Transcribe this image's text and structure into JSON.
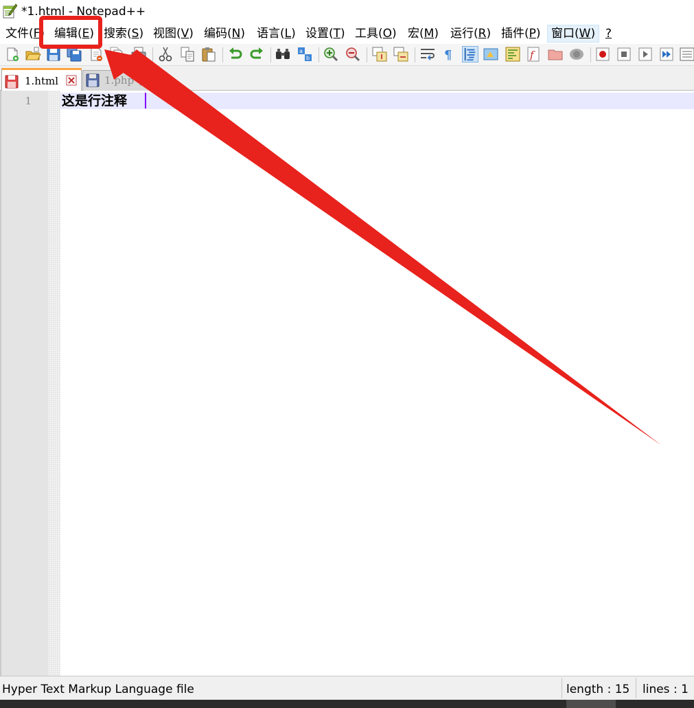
{
  "window": {
    "title": "*1.html - Notepad++"
  },
  "menu": {
    "items": [
      {
        "label": "文件(",
        "key": "F",
        "end": ")"
      },
      {
        "label": "编辑(",
        "key": "E",
        "end": ")"
      },
      {
        "label": "搜索(",
        "key": "S",
        "end": ")"
      },
      {
        "label": "视图(",
        "key": "V",
        "end": ")"
      },
      {
        "label": "编码(",
        "key": "N",
        "end": ")"
      },
      {
        "label": "语言(",
        "key": "L",
        "end": ")"
      },
      {
        "label": "设置(",
        "key": "T",
        "end": ")"
      },
      {
        "label": "工具(",
        "key": "O",
        "end": ")"
      },
      {
        "label": "宏(",
        "key": "M",
        "end": ")"
      },
      {
        "label": "运行(",
        "key": "R",
        "end": ")"
      },
      {
        "label": "插件(",
        "key": "P",
        "end": ")"
      },
      {
        "label": "窗口(",
        "key": "W",
        "end": ")"
      },
      {
        "label": "",
        "key": "?",
        "end": ""
      }
    ],
    "active_item": "窗口"
  },
  "toolbar": {
    "icons": [
      "new-file-icon",
      "open-file-icon",
      "save-icon",
      "save-all-icon",
      "close-icon",
      "close-all-icon",
      "print-icon",
      "cut-icon",
      "copy-icon",
      "paste-icon",
      "undo-icon",
      "redo-icon",
      "find-icon",
      "replace-icon",
      "zoom-in-icon",
      "zoom-out-icon",
      "sync-vertical-icon",
      "sync-horizontal-icon",
      "word-wrap-icon",
      "show-all-characters-icon",
      "indent-guide-icon",
      "user-language-icon",
      "document-map-icon",
      "function-list-icon",
      "folder-as-workspace-icon",
      "monitoring-icon",
      "record-macro-icon",
      "stop-recording-icon",
      "play-macro-icon",
      "run-macro-multiple-icon",
      "save-macro-icon"
    ],
    "pressed_icon": "indent-guide-icon"
  },
  "tabs": [
    {
      "label": "1.html",
      "state": "active",
      "modified": true
    },
    {
      "label": "1.php",
      "state": "inactive",
      "modified": false
    }
  ],
  "editor": {
    "line_number": "1",
    "line_text": "这是行注释"
  },
  "status": {
    "file_type": "Hyper Text Markup Language file",
    "length": "length : 15",
    "lines": "lines : 1"
  },
  "colors": {
    "annotation_red": "#e8221c",
    "active_tab_accent": "#ffa640",
    "current_line": "#e8e8ff",
    "caret": "#8000ff"
  }
}
